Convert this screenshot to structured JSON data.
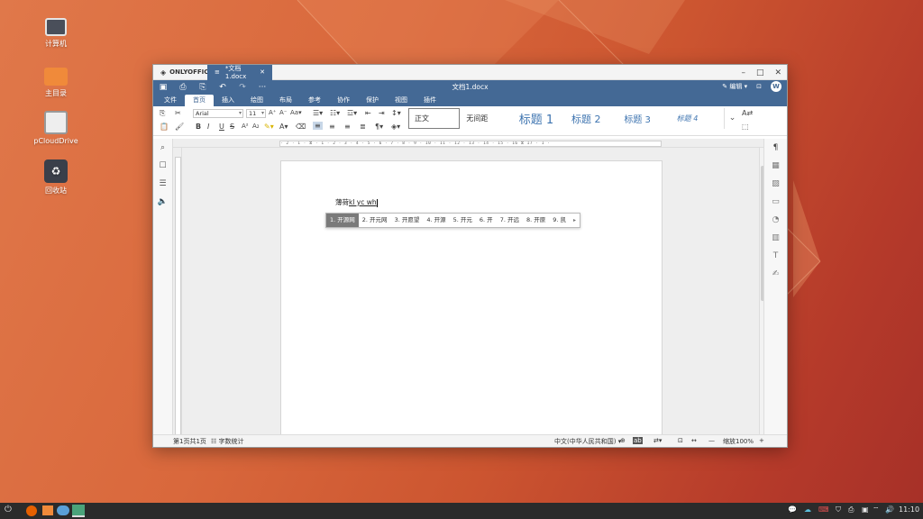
{
  "desktop": {
    "icons": [
      {
        "label": "计算机",
        "icon": "computer-icon"
      },
      {
        "label": "主目录",
        "icon": "home-folder-icon"
      },
      {
        "label": "pCloudDrive",
        "icon": "drive-icon"
      },
      {
        "label": "回收站",
        "icon": "trash-icon"
      }
    ]
  },
  "window": {
    "app_name": "ONLYOFFICE",
    "tab_label": "*文档1.docx",
    "doc_title": "文档1.docx",
    "edit_mode": "编辑",
    "avatar": "W",
    "tabs": [
      "文件",
      "首页",
      "插入",
      "绘图",
      "布局",
      "参考",
      "协作",
      "保护",
      "视图",
      "插件"
    ],
    "active_tab": "首页"
  },
  "toolbar": {
    "font_name": "Arial",
    "font_size": "11",
    "styles": [
      "正文",
      "无间距",
      "标题 1",
      "标题 2",
      "标题 3",
      "标题 4"
    ]
  },
  "ruler": {
    "text": "· 2 · 1 · ⧖ · 1 · 2 · 3 · 4 · 5 · 6 · 7 · 8 · 9 · 10 · 11 · 12 · 13 · 14 · 15 · 16 ⧖ 17 · 1 ·"
  },
  "document": {
    "typed_prefix": "薄荷",
    "typed_composition": "kl yc wh"
  },
  "ime": {
    "candidates": [
      "1. 开源网",
      "2. 开元网",
      "3. 开愿望",
      "4. 开源",
      "5. 开元",
      "6. 开",
      "7. 开远",
      "8. 开原",
      "9. 凯"
    ],
    "more": "▸"
  },
  "statusbar": {
    "page_info": "第1页共1页",
    "word_count": "字数统计",
    "language": "中文(中华人民共和国)",
    "zoom": "缩放100%"
  },
  "taskbar": {
    "time": "11:10"
  }
}
